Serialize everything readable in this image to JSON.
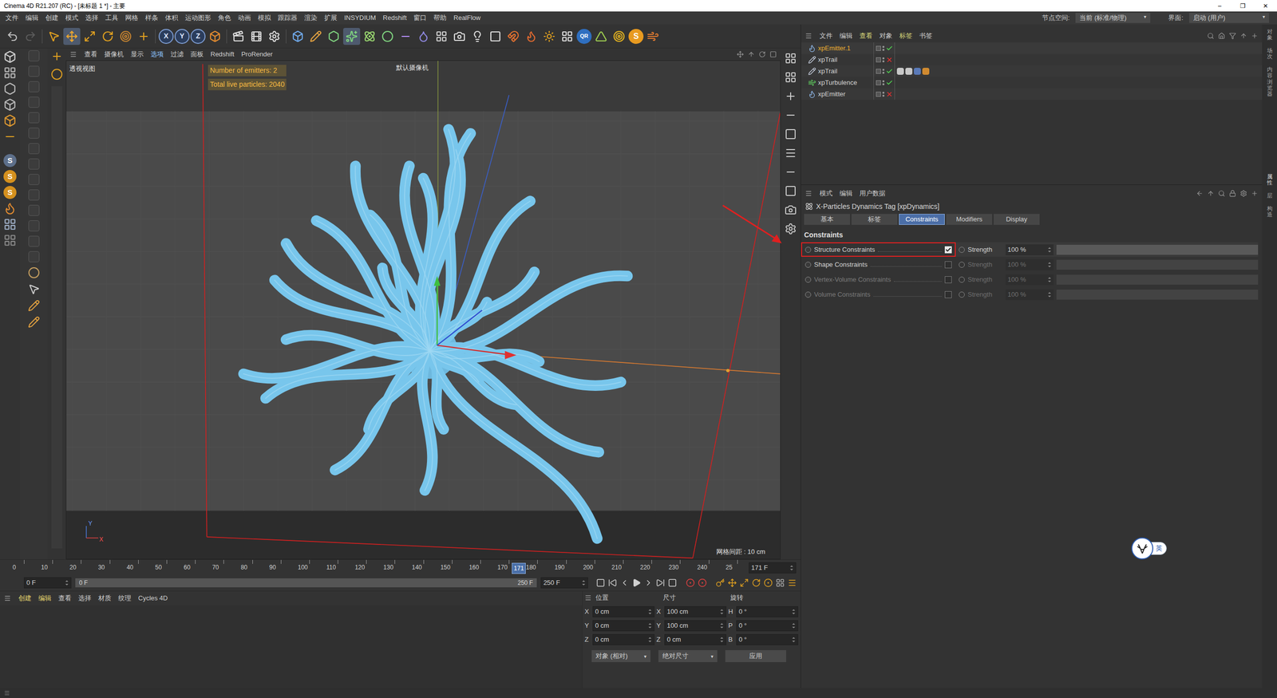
{
  "window": {
    "title": "Cinema 4D R21.207 (RC) - [未标题 1 *] - 主要",
    "controls": [
      "–",
      "❐",
      "✕"
    ]
  },
  "menu": [
    "文件",
    "编辑",
    "创建",
    "模式",
    "选择",
    "工具",
    "网格",
    "样条",
    "体积",
    "运动图形",
    "角色",
    "动画",
    "模拟",
    "跟踪器",
    "渲染",
    "扩展",
    "INSYDIUM",
    "Redshift",
    "窗口",
    "帮助",
    "RealFlow"
  ],
  "node_space": {
    "label": "节点空间:",
    "value": "当前 (标准/物理)"
  },
  "interface": {
    "label": "界面:",
    "value": "启动 (用户)"
  },
  "toolbar": {
    "axis_buttons": [
      "X",
      "Y",
      "Z"
    ],
    "badges": [
      "QR",
      "S"
    ]
  },
  "left_toolbar": {
    "badges": [
      "S",
      "S",
      "S"
    ]
  },
  "viewport": {
    "menu": [
      {
        "label": "查看",
        "selected": false
      },
      {
        "label": "摄像机",
        "selected": false
      },
      {
        "label": "显示",
        "selected": false
      },
      {
        "label": "选项",
        "selected": true
      },
      {
        "label": "过滤",
        "selected": false
      },
      {
        "label": "面板",
        "selected": false
      },
      {
        "label": "Redshift",
        "selected": false
      },
      {
        "label": "ProRender",
        "selected": false
      }
    ],
    "view_name": "透视视图",
    "camera": "默认摄像机",
    "hud": [
      "Number of emitters: 2",
      "Total live particles: 2040"
    ],
    "grid": "网格间距 : 10 cm",
    "axes": [
      "Y",
      "X"
    ]
  },
  "timeline": {
    "ticks": [
      "0",
      "10",
      "20",
      "30",
      "40",
      "50",
      "60",
      "70",
      "80",
      "90",
      "100",
      "110",
      "120",
      "130",
      "140",
      "150",
      "160",
      "170",
      "180",
      "190",
      "200",
      "210",
      "220",
      "230",
      "240",
      "25"
    ],
    "level": 0.684,
    "current_label": "171",
    "frame_field": "171 F",
    "start_field": "0 F",
    "range_start": "0 F",
    "range_end": "250 F",
    "end_field": "250 F"
  },
  "object_manager": {
    "menu": [
      {
        "label": "文件",
        "highlighted": false
      },
      {
        "label": "编辑",
        "highlighted": false
      },
      {
        "label": "查看",
        "highlighted": true
      },
      {
        "label": "对象",
        "highlighted": false
      },
      {
        "label": "标签",
        "highlighted": true
      },
      {
        "label": "书签",
        "highlighted": false
      }
    ],
    "objects": [
      {
        "name": "xpEmitter.1",
        "kind": "emitter",
        "selected": true,
        "enabled": true,
        "tag_count": 0
      },
      {
        "name": "xpTrail",
        "kind": "trail",
        "selected": false,
        "enabled": false,
        "tag_count": 0
      },
      {
        "name": "xpTrail",
        "kind": "trail",
        "selected": false,
        "enabled": true,
        "tag_count": 4
      },
      {
        "name": "xpTurbulence",
        "kind": "turbulence",
        "selected": false,
        "enabled": true,
        "tag_count": 0
      },
      {
        "name": "xpEmitter",
        "kind": "emitter",
        "selected": false,
        "enabled": false,
        "tag_count": 0
      }
    ]
  },
  "attributes": {
    "menu": [
      "模式",
      "编辑",
      "用户数据"
    ],
    "title": "X-Particles Dynamics Tag [xpDynamics]",
    "tabs": [
      {
        "label": "基本",
        "selected": false
      },
      {
        "label": "标签",
        "selected": false
      },
      {
        "label": "Constraints",
        "selected": true
      },
      {
        "label": "Modifiers",
        "selected": false
      },
      {
        "label": "Display",
        "selected": false
      }
    ],
    "section": "Constraints",
    "rows": [
      {
        "label": "Structure Constraints",
        "checked": true,
        "enabled": true,
        "highlighted": true,
        "strength_label": "Strength",
        "strength": "100 %",
        "level": 1
      },
      {
        "label": "Shape Constraints",
        "checked": false,
        "enabled": true,
        "highlighted": false,
        "strength_label": "Strength",
        "strength": "100 %",
        "level": 1
      },
      {
        "label": "Vertex-Volume Constraints",
        "checked": false,
        "enabled": false,
        "highlighted": false,
        "strength_label": "Strength",
        "strength": "100 %",
        "level": 1
      },
      {
        "label": "Volume Constraints",
        "checked": false,
        "enabled": false,
        "highlighted": false,
        "strength_label": "Strength",
        "strength": "100 %",
        "level": 1
      }
    ]
  },
  "material_manager": {
    "menu": [
      {
        "label": "创建",
        "highlighted": true
      },
      {
        "label": "编辑",
        "highlighted": true
      },
      {
        "label": "查看",
        "highlighted": false
      },
      {
        "label": "选择",
        "highlighted": false
      },
      {
        "label": "材质",
        "highlighted": false
      },
      {
        "label": "纹理",
        "highlighted": false
      },
      {
        "label": "Cycles 4D",
        "highlighted": false
      }
    ]
  },
  "coordinates": {
    "headers": [
      "位置",
      "尺寸",
      "旋转"
    ],
    "rows": [
      {
        "pos_axis": "X",
        "pos": "0 cm",
        "size_axis": "X",
        "size": "100 cm",
        "rot_axis": "H",
        "rot": "0 °"
      },
      {
        "pos_axis": "Y",
        "pos": "0 cm",
        "size_axis": "Y",
        "size": "100 cm",
        "rot_axis": "P",
        "rot": "0 °"
      },
      {
        "pos_axis": "Z",
        "pos": "0 cm",
        "size_axis": "Z",
        "size": "0 cm",
        "rot_axis": "B",
        "rot": "0 °"
      }
    ],
    "mode": "对象 (相对)",
    "size_mode": "绝对尺寸",
    "apply": "应用"
  },
  "side_tabs_top": [
    "对象",
    "场次",
    "内容浏览器"
  ],
  "side_tabs_bottom": [
    "属性",
    "层",
    "构造"
  ],
  "ime": "英"
}
